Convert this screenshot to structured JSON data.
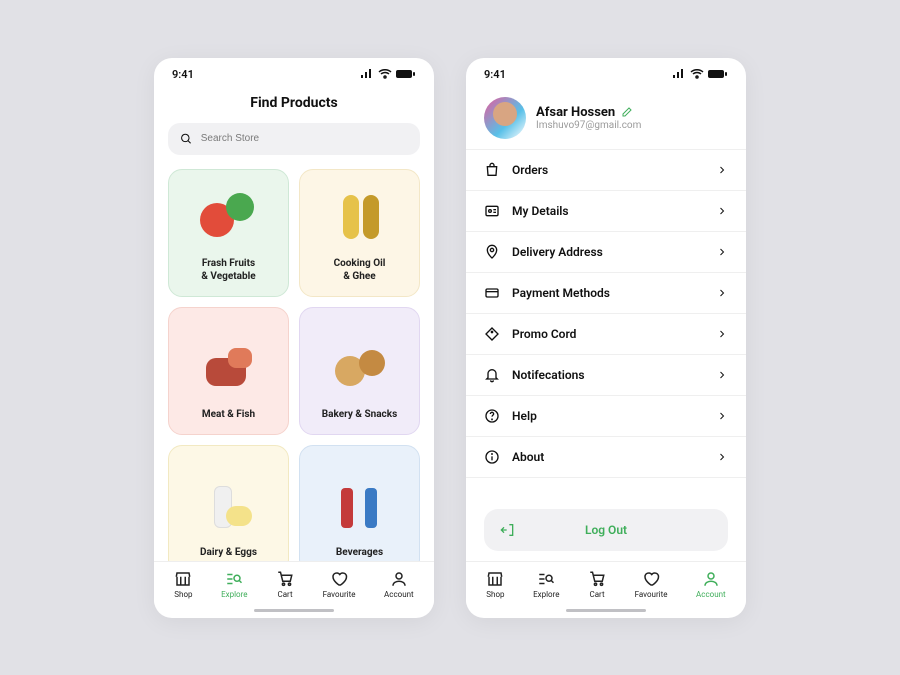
{
  "status": {
    "time": "9:41"
  },
  "colors": {
    "accent": "#3fae5a"
  },
  "explore": {
    "title": "Find Products",
    "search": {
      "placeholder": "Search Store"
    },
    "categories": [
      {
        "label": "Frash Fruits\n& Vegetable"
      },
      {
        "label": "Cooking Oil\n& Ghee"
      },
      {
        "label": "Meat & Fish"
      },
      {
        "label": "Bakery & Snacks"
      },
      {
        "label": "Dairy & Eggs"
      },
      {
        "label": "Beverages"
      }
    ],
    "nav": {
      "items": [
        {
          "label": "Shop"
        },
        {
          "label": "Explore"
        },
        {
          "label": "Cart"
        },
        {
          "label": "Favourite"
        },
        {
          "label": "Account"
        }
      ],
      "activeIndex": 1
    }
  },
  "account": {
    "profile": {
      "name": "Afsar Hossen",
      "email": "Imshuvo97@gmail.com"
    },
    "menu": [
      {
        "label": "Orders"
      },
      {
        "label": "My Details"
      },
      {
        "label": "Delivery Address"
      },
      {
        "label": "Payment Methods"
      },
      {
        "label": "Promo Cord"
      },
      {
        "label": "Notifecations"
      },
      {
        "label": "Help"
      },
      {
        "label": "About"
      }
    ],
    "logout": "Log Out",
    "nav": {
      "items": [
        {
          "label": "Shop"
        },
        {
          "label": "Explore"
        },
        {
          "label": "Cart"
        },
        {
          "label": "Favourite"
        },
        {
          "label": "Account"
        }
      ],
      "activeIndex": 4
    }
  }
}
